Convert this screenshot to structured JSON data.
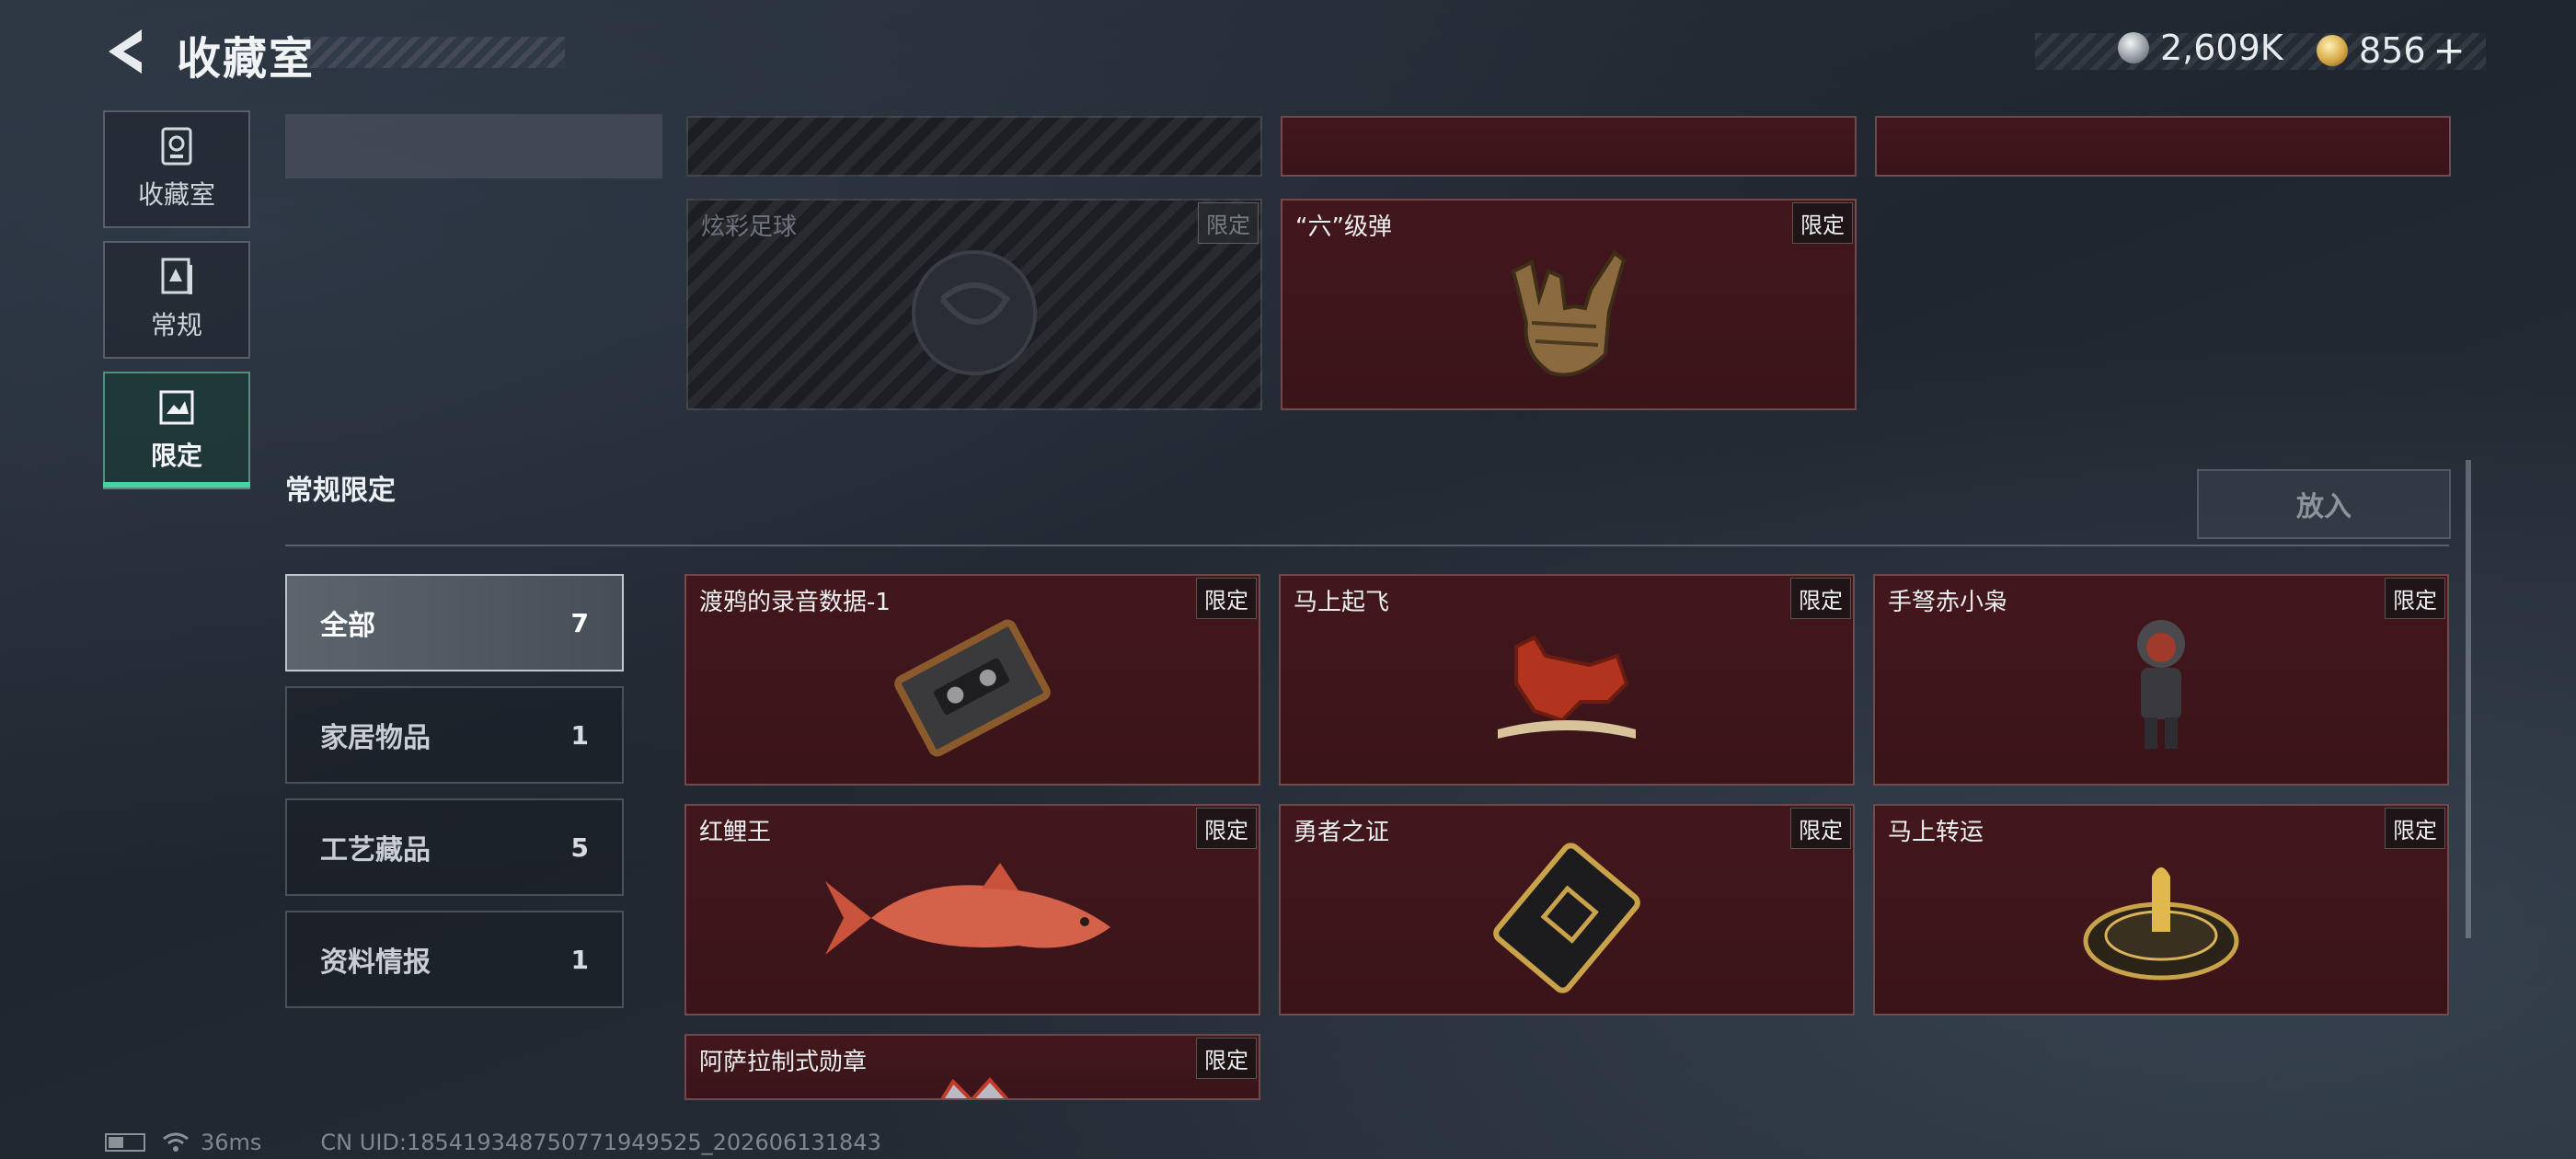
{
  "header": {
    "title": "收藏室"
  },
  "currency": {
    "silver": "2,609K",
    "gold": "856",
    "plus": "+"
  },
  "nav": [
    {
      "label": "收藏室",
      "icon": "trophy-icon"
    },
    {
      "label": "常规",
      "icon": "book-icon"
    },
    {
      "label": "限定",
      "icon": "image-icon",
      "active": true
    }
  ],
  "top_cards": [
    {
      "name": "炫彩足球",
      "tag": "限定",
      "locked": true
    },
    {
      "name": "“六”级弹",
      "tag": "限定"
    }
  ],
  "section": {
    "title": "常规限定",
    "put_label": "放入"
  },
  "filters": [
    {
      "label": "全部",
      "count": "7",
      "active": true
    },
    {
      "label": "家居物品",
      "count": "1"
    },
    {
      "label": "工艺藏品",
      "count": "5"
    },
    {
      "label": "资料情报",
      "count": "1"
    }
  ],
  "items": [
    {
      "name": "渡鸦的录音数据-1",
      "tag": "限定",
      "art": "cassette-icon"
    },
    {
      "name": "马上起飞",
      "tag": "限定",
      "art": "horse-icon"
    },
    {
      "name": "手弩赤小枭",
      "tag": "限定",
      "art": "figure-icon"
    },
    {
      "name": "红鲤王",
      "tag": "限定",
      "art": "carp-icon"
    },
    {
      "name": "勇者之证",
      "tag": "限定",
      "art": "card-icon"
    },
    {
      "name": "马上转运",
      "tag": "限定",
      "art": "turntable-icon"
    },
    {
      "name": "阿萨拉制式勋章",
      "tag": "限定",
      "art": "medal-icon"
    }
  ],
  "status": {
    "ping": "36ms",
    "uid": "CN UID:18541934875077194952‌5_202606131843"
  },
  "colors": {
    "accent": "#46d3a0",
    "card_bg": "#42171c"
  }
}
